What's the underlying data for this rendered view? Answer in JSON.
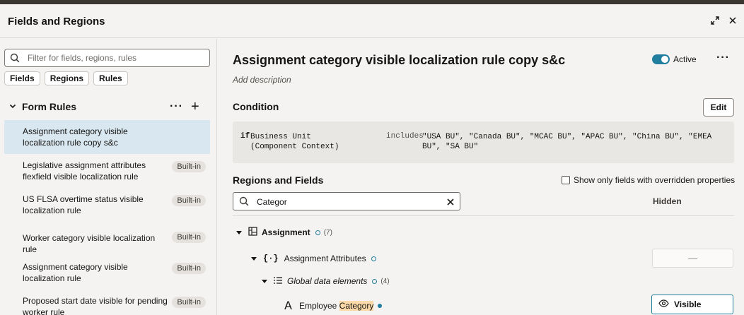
{
  "dialog": {
    "title": "Fields and Regions"
  },
  "left": {
    "search_placeholder": "Filter for fields, regions, rules",
    "filter_chips": [
      "Fields",
      "Regions",
      "Rules"
    ],
    "section_label": "Form Rules",
    "more_label": "···",
    "add_label": "+",
    "rules": [
      {
        "label": "Assignment category visible localization rule copy s&c",
        "badge": "",
        "selected": true
      },
      {
        "label": "Legislative assignment attributes flexfield visible localization rule",
        "badge": "Built-in"
      },
      {
        "label": "US FLSA overtime status visible localization rule",
        "badge": "Built-in"
      },
      {
        "label": "Worker category visible localization rule",
        "badge": "Built-in"
      },
      {
        "label": "Assignment category visible localization rule",
        "badge": "Built-in"
      },
      {
        "label": "Proposed start date visible for pending worker rule",
        "badge": "Built-in"
      }
    ]
  },
  "detail": {
    "title": "Assignment category visible localization rule copy s&c",
    "status_label": "Active",
    "status_on": true,
    "more_label": "···",
    "description_placeholder": "Add description",
    "condition": {
      "heading": "Condition",
      "edit_label": "Edit",
      "keyword": "if",
      "field": "Business Unit (Component Context)",
      "operator": "includes",
      "values": "\"USA BU\", \"Canada BU\", \"MCAC BU\", \"APAC BU\", \"China BU\", \"EMEA BU\", \"SA BU\""
    },
    "regions": {
      "heading": "Regions and Fields",
      "override_checkbox_label": "Show only fields with overridden properties",
      "override_checked": false,
      "search_value": "Categor",
      "column_hidden": "Hidden",
      "tree": {
        "assignment": {
          "label": "Assignment",
          "count": "(7)"
        },
        "attributes": {
          "label": "Assignment Attributes",
          "value": "—"
        },
        "global": {
          "label": "Global data elements",
          "count": "(4)"
        },
        "employee": {
          "label_prefix": "Employee ",
          "label_match": "Category",
          "value": "Visible"
        }
      }
    }
  },
  "colors": {
    "accent": "#227e9e",
    "selected_row": "#d9e7f0",
    "highlight": "#fbd9a9"
  }
}
